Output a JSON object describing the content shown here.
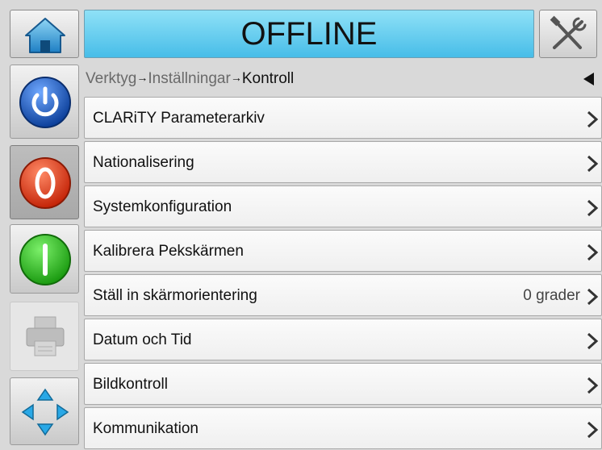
{
  "header": {
    "home_icon": "home-icon",
    "status": "OFFLINE",
    "status_color": "#47bde8",
    "tools_icon": "tools-icon"
  },
  "sidebar": {
    "buttons": [
      {
        "name": "power",
        "icon": "power-icon",
        "color": "#1a5fb4"
      },
      {
        "name": "stop",
        "icon": "stop-icon",
        "color": "#e53b1c"
      },
      {
        "name": "start",
        "icon": "start-icon",
        "color": "#2bbf1c"
      },
      {
        "name": "print",
        "icon": "printer-icon",
        "state": "disabled"
      },
      {
        "name": "navigate",
        "icon": "navigation-arrows-icon",
        "color": "#1aa3e0"
      }
    ]
  },
  "breadcrumb": {
    "items": [
      "Verktyg",
      "Inställningar",
      "Kontroll"
    ],
    "separator": "→",
    "back_icon": "back-triangle-icon"
  },
  "menu": {
    "items": [
      {
        "label": "CLARiTY Parameterarkiv",
        "value": ""
      },
      {
        "label": "Nationalisering",
        "value": ""
      },
      {
        "label": "Systemkonfiguration",
        "value": ""
      },
      {
        "label": "Kalibrera Pekskärmen",
        "value": ""
      },
      {
        "label": "Ställ in skärmorientering",
        "value": "0 grader"
      },
      {
        "label": "Datum och Tid",
        "value": ""
      },
      {
        "label": "Bildkontroll",
        "value": ""
      },
      {
        "label": "Kommunikation",
        "value": ""
      }
    ]
  }
}
